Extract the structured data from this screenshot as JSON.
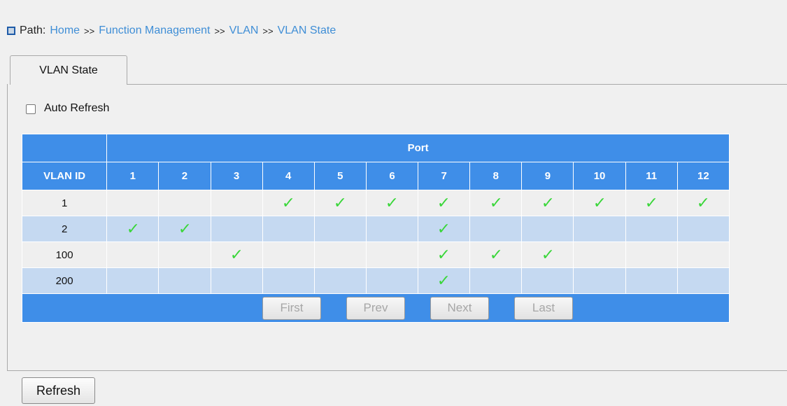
{
  "path": {
    "label": "Path:",
    "crumbs": [
      "Home",
      "Function Management",
      "VLAN",
      "VLAN State"
    ],
    "separator": ">>"
  },
  "tab": {
    "label": "VLAN State"
  },
  "auto_refresh": {
    "label": "Auto Refresh",
    "checked": false
  },
  "table": {
    "port_header": "Port",
    "vlan_id_header": "VLAN ID",
    "ports": [
      "1",
      "2",
      "3",
      "4",
      "5",
      "6",
      "7",
      "8",
      "9",
      "10",
      "11",
      "12"
    ],
    "check_glyph": "✓",
    "rows": [
      {
        "vlan_id": "1",
        "members": [
          false,
          false,
          false,
          true,
          true,
          true,
          true,
          true,
          true,
          true,
          true,
          true
        ]
      },
      {
        "vlan_id": "2",
        "members": [
          true,
          true,
          false,
          false,
          false,
          false,
          true,
          false,
          false,
          false,
          false,
          false
        ]
      },
      {
        "vlan_id": "100",
        "members": [
          false,
          false,
          true,
          false,
          false,
          false,
          true,
          true,
          true,
          false,
          false,
          false
        ]
      },
      {
        "vlan_id": "200",
        "members": [
          false,
          false,
          false,
          false,
          false,
          false,
          true,
          false,
          false,
          false,
          false,
          false
        ]
      }
    ]
  },
  "pager": {
    "first": "First",
    "prev": "Prev",
    "next": "Next",
    "last": "Last"
  },
  "refresh_button": "Refresh",
  "colors": {
    "header_blue": "#3f8ee8",
    "row_alt_blue": "#c5d9f1",
    "row_gray": "#efefef",
    "check_green": "#38d638",
    "link_blue": "#3f8ed6"
  }
}
